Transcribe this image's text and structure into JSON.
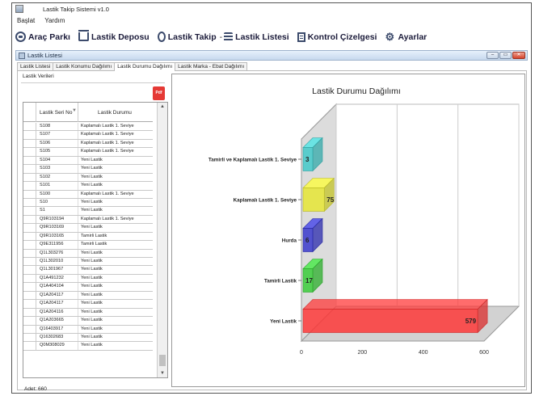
{
  "app": {
    "title": "Lastik Takip Sistemi v1.0"
  },
  "menu": [
    "Başlat",
    "Yardım"
  ],
  "toolbar": {
    "items": [
      {
        "label": "Araç Parkı",
        "icon": "car-icon"
      },
      {
        "label": "Lastik Deposu",
        "icon": "warehouse-icon"
      },
      {
        "label": "Lastik Takip",
        "icon": "tire-icon"
      },
      {
        "label": "Lastik Listesi",
        "icon": "list-icon"
      },
      {
        "label": "Kontrol Çizelgesi",
        "icon": "checklist-icon"
      },
      {
        "label": "Ayarlar",
        "icon": "gear-icon"
      }
    ],
    "separator": "-"
  },
  "window": {
    "title": "Lastik Listesi",
    "buttons": {
      "minimize": "–",
      "restore": "▭",
      "close": "✕"
    }
  },
  "tabs": [
    "Lastik Listesi",
    "Lastik Konumu Dağılımı",
    "Lastik Durumu Dağılımı",
    "Lastik Marka - Ebat Dağılımı"
  ],
  "active_tab": 2,
  "left_panel": {
    "group_label": "Lastik Verileri",
    "pdf_label": "Pdf",
    "grid": {
      "columns": [
        "Lastik Seri No",
        "Lastik Durumu"
      ],
      "filter_symbol": "▼",
      "rows": [
        [
          "S108",
          "Kaplamalı Lastik 1. Seviye"
        ],
        [
          "S107",
          "Kaplamalı Lastik 1. Seviye"
        ],
        [
          "S106",
          "Kaplamalı Lastik 1. Seviye"
        ],
        [
          "S105",
          "Kaplamalı Lastik 1. Seviye"
        ],
        [
          "S104",
          "Yeni Lastik"
        ],
        [
          "S103",
          "Yeni Lastik"
        ],
        [
          "S102",
          "Yeni Lastik"
        ],
        [
          "S101",
          "Yeni Lastik"
        ],
        [
          "S100",
          "Kaplamalı Lastik 1. Seviye"
        ],
        [
          "S10",
          "Yeni Lastik"
        ],
        [
          "S1",
          "Yeni Lastik"
        ],
        [
          "Q9R103194",
          "Kaplamalı Lastik 1. Seviye"
        ],
        [
          "Q9R103169",
          "Yeni Lastik"
        ],
        [
          "Q9R103165",
          "Tamirli Lastik"
        ],
        [
          "Q9E311956",
          "Tamirli Lastik"
        ],
        [
          "Q1L303276",
          "Yeni Lastik"
        ],
        [
          "Q1L302010",
          "Yeni Lastik"
        ],
        [
          "Q1L301967",
          "Yeni Lastik"
        ],
        [
          "Q1A491232",
          "Yeni Lastik"
        ],
        [
          "Q1A404104",
          "Yeni Lastik"
        ],
        [
          "Q1A204117",
          "Yeni Lastik"
        ],
        [
          "Q1A204117",
          "Yeni Lastik"
        ],
        [
          "Q1A204116",
          "Yeni Lastik"
        ],
        [
          "Q1A203665",
          "Yeni Lastik"
        ],
        [
          "Q16403917",
          "Yeni Lastik"
        ],
        [
          "Q16302683",
          "Yeni Lastik"
        ],
        [
          "Q0M308029",
          "Yeni Lastik"
        ]
      ]
    },
    "scroll_up": "▲",
    "scroll_down": "▼",
    "count_text": "Adet: 660"
  },
  "chart_data": {
    "type": "bar",
    "orientation": "horizontal",
    "style": "3d",
    "title": "Lastik Durumu Dağılımı",
    "categories": [
      "Tamirli ve Kaplamalı Lastik 1. Seviye",
      "Kaplamalı Lastik 1. Seviye",
      "Hurda",
      "Tamirli Lastik",
      "Yeni Lastik"
    ],
    "values": [
      3,
      75,
      6,
      17,
      579
    ],
    "colors": [
      "#3cc8c8",
      "#e6e62e",
      "#3333cc",
      "#33cc33",
      "#ff3333"
    ],
    "xlim": [
      0,
      600
    ],
    "xticks": [
      0,
      200,
      400,
      600
    ],
    "grid": true
  }
}
